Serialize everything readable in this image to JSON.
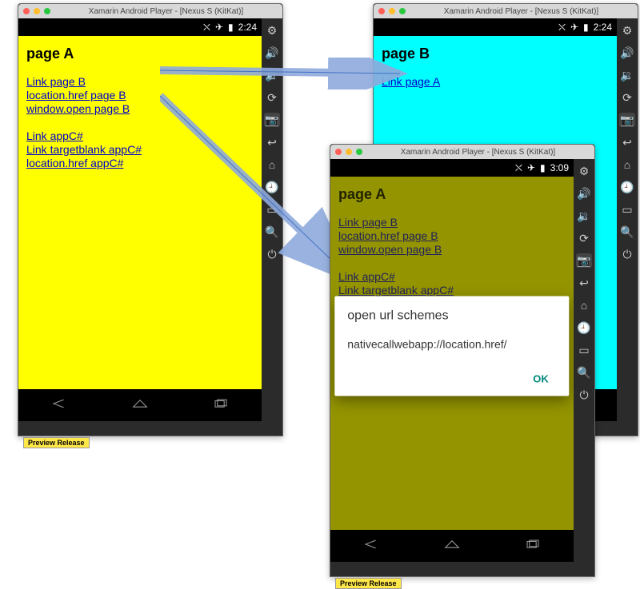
{
  "emulator_title": "Xamarin Android Player - [Nexus S (KitKat)]",
  "preview_label": "Preview Release",
  "statusbar": {
    "time_a": "2:24",
    "time_c": "3:09"
  },
  "pageA": {
    "bg": "#ffff00",
    "title": "page A",
    "links_group1": [
      "Link page B",
      "location.href page B",
      "window.open page B"
    ],
    "links_group2": [
      "Link appC#",
      "Link targetblank appC#",
      "location.href appC#"
    ]
  },
  "pageB": {
    "bg": "#00ffff",
    "title": "page B",
    "links": [
      "Link page A"
    ]
  },
  "dialog": {
    "title": "open url schemes",
    "message": "nativecallwebapp://location.href/",
    "ok": "OK"
  },
  "side_icons": [
    "gear",
    "volume-up",
    "volume-down",
    "refresh",
    "camera",
    "back",
    "home",
    "clock",
    "crop",
    "search",
    "power"
  ]
}
